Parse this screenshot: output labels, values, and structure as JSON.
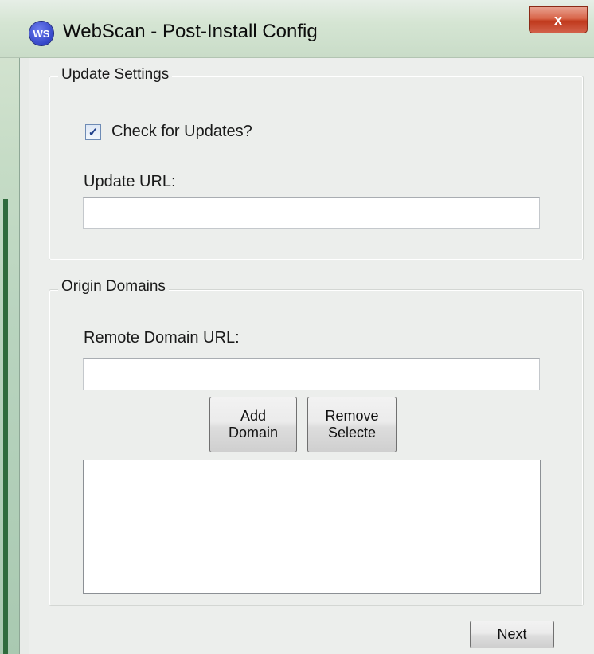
{
  "window": {
    "title": "WebScan - Post-Install Config",
    "icon_text": "WS",
    "close_glyph": "x"
  },
  "update_settings": {
    "group_label": "Update Settings",
    "check_label": "Check for Updates?",
    "check_checked": true,
    "check_glyph": "✓",
    "url_label": "Update URL:",
    "url_value": ""
  },
  "origin_domains": {
    "group_label": "Origin Domains",
    "url_label": "Remote Domain URL:",
    "url_value": "",
    "add_button_line1": "Add",
    "add_button_line2": "Domain",
    "remove_button_line1": "Remove",
    "remove_button_line2": "Selecte",
    "domains": []
  },
  "footer": {
    "next_label": "Next"
  },
  "colors": {
    "accent_close": "#c0391c",
    "icon_blue": "#3446c8",
    "frame_green": "#2f6b3d"
  }
}
